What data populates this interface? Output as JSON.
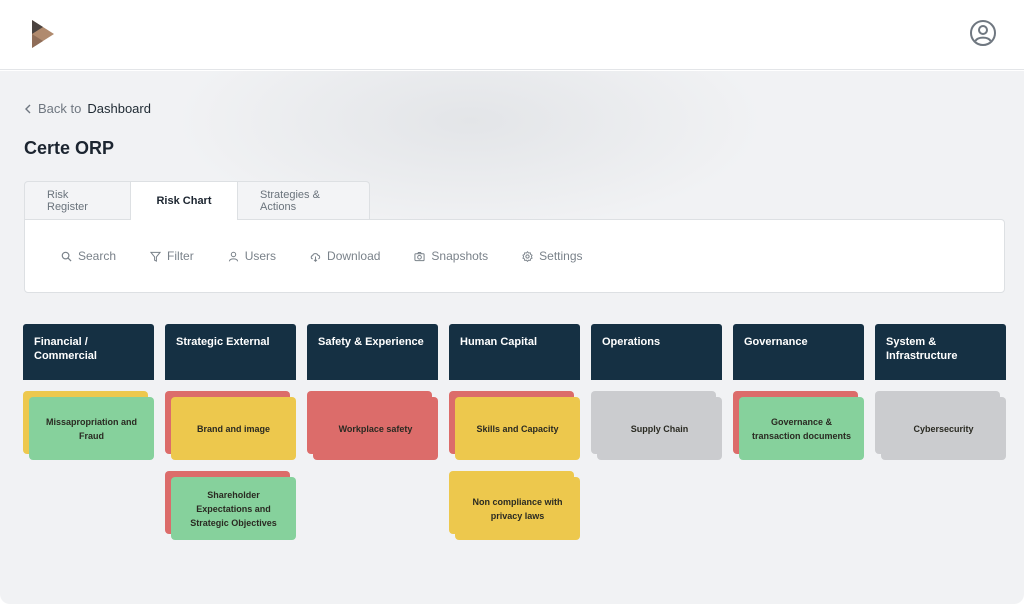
{
  "header": {
    "logo_icon": "play-logo-icon",
    "account_icon": "user-circle-icon"
  },
  "nav": {
    "back_prefix": "Back to",
    "back_target": "Dashboard"
  },
  "page": {
    "title": "Certe ORP"
  },
  "tabs": [
    {
      "label": "Risk Register",
      "active": false
    },
    {
      "label": "Risk Chart",
      "active": true
    },
    {
      "label": "Strategies & Actions",
      "active": false
    }
  ],
  "toolbar": {
    "search": "Search",
    "filter": "Filter",
    "users": "Users",
    "download": "Download",
    "snapshots": "Snapshots",
    "settings": "Settings"
  },
  "colors": {
    "header_bg": "#153043",
    "green": "#86d19c",
    "yellow": "#edc84d",
    "red": "#dc6c6a",
    "gray": "#cbcccf"
  },
  "columns": [
    {
      "title": "Financial / Commercial",
      "cards": [
        {
          "label": "Missapropriation and Fraud",
          "color": "#86d19c",
          "back": "#edc84d"
        }
      ]
    },
    {
      "title": "Strategic External",
      "cards": [
        {
          "label": "Brand and image",
          "color": "#edc84d",
          "back": "#dc6c6a"
        },
        {
          "label": "Shareholder Expectations and Strategic Objectives",
          "color": "#86d19c",
          "back": "#dc6c6a"
        }
      ]
    },
    {
      "title": "Safety & Experience",
      "cards": [
        {
          "label": "Workplace safety",
          "color": "#dc6c6a",
          "back": "#dc6c6a"
        }
      ]
    },
    {
      "title": "Human Capital",
      "cards": [
        {
          "label": "Skills and Capacity",
          "color": "#edc84d",
          "back": "#dc6c6a"
        },
        {
          "label": "Non compliance with privacy laws",
          "color": "#edc84d",
          "back": "#edc84d"
        }
      ]
    },
    {
      "title": "Operations",
      "cards": [
        {
          "label": "Supply Chain",
          "color": "#cbcccf",
          "back": "#cbcccf"
        }
      ]
    },
    {
      "title": "Governance",
      "cards": [
        {
          "label": "Governance & transaction documents",
          "color": "#86d19c",
          "back": "#dc6c6a"
        }
      ]
    },
    {
      "title": "System & Infrastructure",
      "cards": [
        {
          "label": "Cybersecurity",
          "color": "#cbcccf",
          "back": "#cbcccf"
        }
      ]
    }
  ]
}
